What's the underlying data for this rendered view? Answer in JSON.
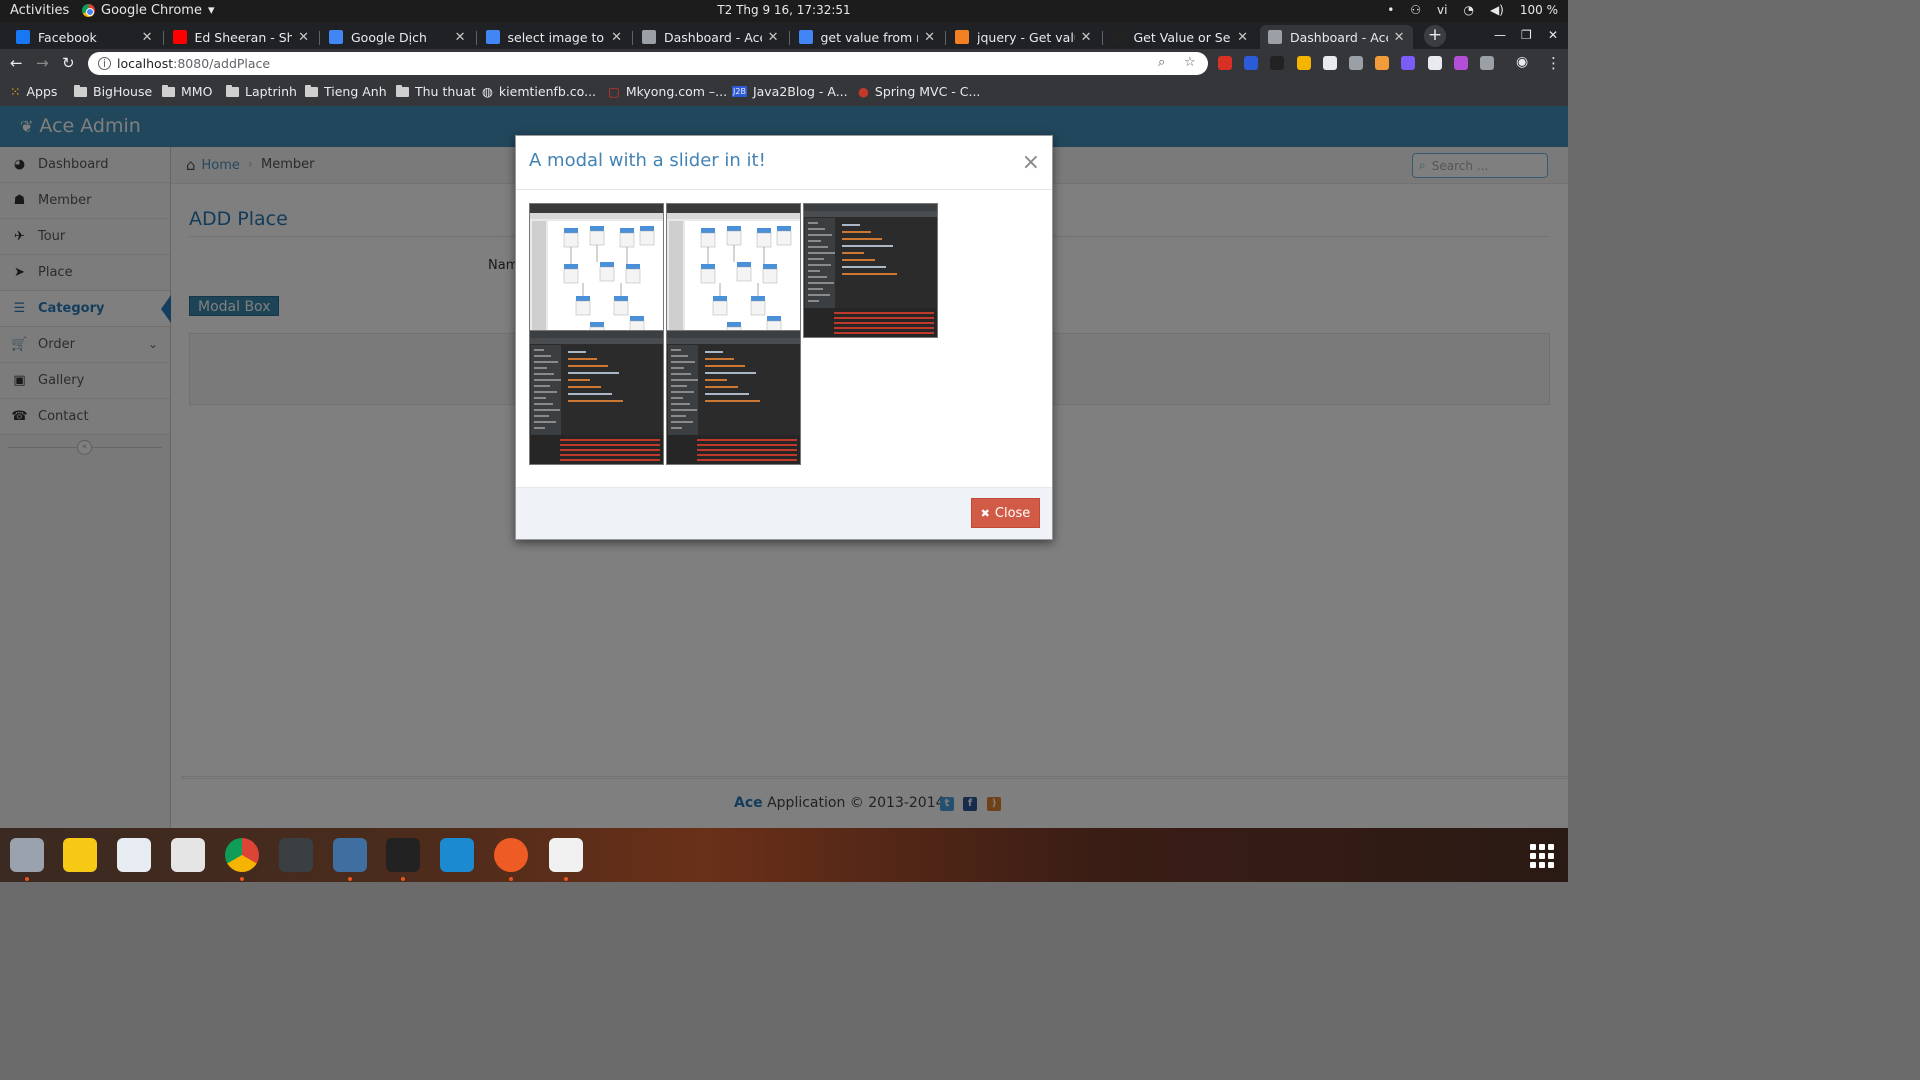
{
  "topbar": {
    "activities": "Activities",
    "app_name": "Google Chrome",
    "clock": "T2 Thg 9 16, 17:32:51",
    "lang": "vi",
    "battery": "100 %"
  },
  "tabs": [
    {
      "title": "Facebook",
      "icon": "facebook-icon",
      "color": "#1877f2"
    },
    {
      "title": "Ed Sheeran - Shape of You",
      "icon": "youtube-icon",
      "color": "#ff0000"
    },
    {
      "title": "Google Dịch",
      "icon": "google-translate-icon",
      "color": "#4285f4"
    },
    {
      "title": "select image to category",
      "icon": "google-icon",
      "color": "#4285f4"
    },
    {
      "title": "Dashboard - Ace Admin",
      "icon": "globe-icon",
      "color": "#9aa0a6"
    },
    {
      "title": "get value from modal",
      "icon": "google-icon",
      "color": "#4285f4"
    },
    {
      "title": "jquery - Get value from",
      "icon": "stackoverflow-icon",
      "color": "#f48024"
    },
    {
      "title": "Get Value or Selected",
      "icon": "dotnet-icon",
      "color": "#222222"
    },
    {
      "title": "Dashboard - Ace Admin",
      "icon": "globe-icon",
      "color": "#9aa0a6",
      "active": true
    }
  ],
  "toolbar": {
    "url_host": "localhost",
    "url_path": ":8080/addPlace"
  },
  "bookmarks": [
    {
      "label": "Apps",
      "icon": "apps-grid-icon"
    },
    {
      "label": "BigHouse",
      "icon": "folder-icon"
    },
    {
      "label": "MMO",
      "icon": "folder-icon"
    },
    {
      "label": "Laptrinh",
      "icon": "folder-icon"
    },
    {
      "label": "Tieng Anh",
      "icon": "folder-icon"
    },
    {
      "label": "Thu thuat",
      "icon": "folder-icon"
    },
    {
      "label": "kiemtienfb.co...",
      "icon": "globe-icon"
    },
    {
      "label": "Mkyong.com –...",
      "icon": "mkyong-icon"
    },
    {
      "label": "Java2Blog - A...",
      "icon": "java2blog-icon"
    },
    {
      "label": "Spring MVC - C...",
      "icon": "spring-icon"
    }
  ],
  "app": {
    "brand": "Ace Admin",
    "sidebar": [
      {
        "label": "Dashboard",
        "icon": "tachometer-icon"
      },
      {
        "label": "Member",
        "icon": "users-icon"
      },
      {
        "label": "Tour",
        "icon": "plane-icon"
      },
      {
        "label": "Place",
        "icon": "location-arrow-icon"
      },
      {
        "label": "Category",
        "icon": "list-alt-icon",
        "active": true
      },
      {
        "label": "Order",
        "icon": "cart-icon",
        "has_children": true
      },
      {
        "label": "Gallery",
        "icon": "picture-icon"
      },
      {
        "label": "Contact",
        "icon": "phone-icon"
      }
    ],
    "breadcrumb": {
      "home": "Home",
      "current": "Member"
    },
    "search_placeholder": "Search ...",
    "page_title": "ADD Place",
    "name_label": "Nam",
    "modal_button": "Modal Box",
    "footer": {
      "brand": "Ace",
      "text": "Application © 2013-2014"
    }
  },
  "modal": {
    "title": "A modal with a slider in it!",
    "close_x": "×",
    "close_button": "Close",
    "images": [
      {
        "kind": "light-diagram"
      },
      {
        "kind": "light-diagram"
      },
      {
        "kind": "dark-ide"
      },
      {
        "kind": "dark-ide"
      },
      {
        "kind": "dark-ide-console"
      }
    ]
  },
  "dock": [
    {
      "name": "files-icon",
      "color": "#9aa3ad"
    },
    {
      "name": "rhythmbox-icon",
      "color": "#f6c915"
    },
    {
      "name": "text-editor-icon",
      "color": "#e7ecf3"
    },
    {
      "name": "software-store-icon",
      "color": "#e5e5e5"
    },
    {
      "name": "chrome-icon",
      "color": "#4285f4"
    },
    {
      "name": "terminal-icon",
      "color": "#3a3f44"
    },
    {
      "name": "mysql-workbench-icon",
      "color": "#3f6fa0"
    },
    {
      "name": "intellij-icon",
      "color": "#222"
    },
    {
      "name": "webstorm-icon",
      "color": "#1c8ad1"
    },
    {
      "name": "postman-icon",
      "color": "#ef5b25"
    },
    {
      "name": "draw-icon",
      "color": "#f0f0f0"
    }
  ]
}
